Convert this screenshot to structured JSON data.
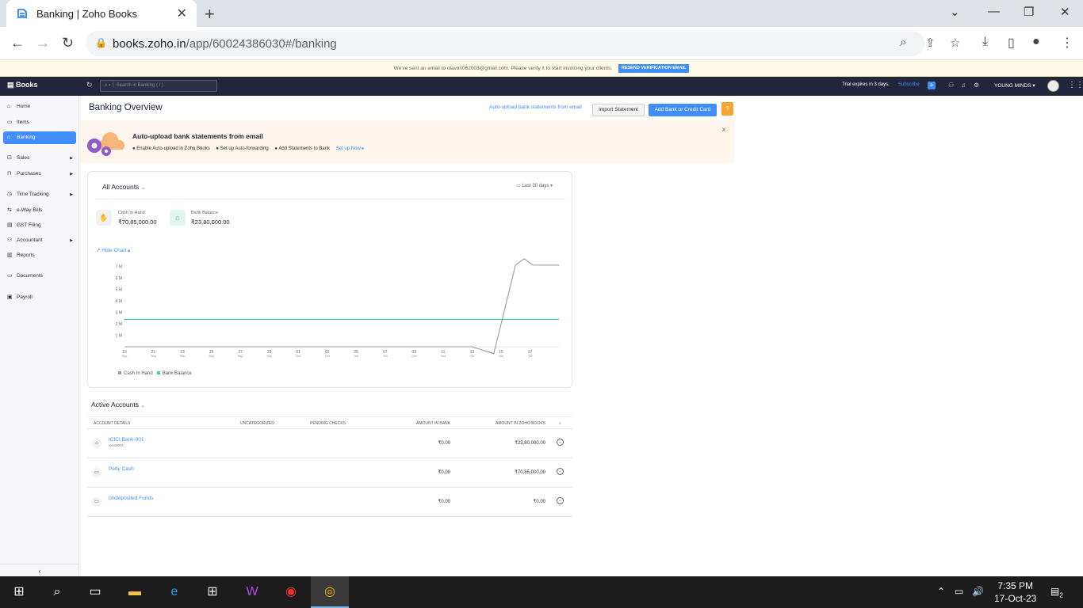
{
  "browser": {
    "tab_title": "Banking | Zoho Books",
    "url_host": "books.zoho.in",
    "url_path": "/app/60024386030#/banking"
  },
  "notice": {
    "text": "We've sent an email to olavori062003@gmail.com. Please verify it to start invoicing your clients.",
    "button": "RESEND VERIFICATION EMAIL"
  },
  "header": {
    "brand": "Books",
    "search_placeholder": "Search in Banking ( / )",
    "trial": "Trial expires in 3 days.",
    "subscribe": "Subscribe",
    "org": "YOUNG MINDS ▾"
  },
  "sidebar": {
    "items": [
      {
        "label": "Home",
        "icon": "home-icon"
      },
      {
        "label": "Items",
        "icon": "items-icon"
      },
      {
        "label": "Banking",
        "icon": "bank-icon",
        "active": true
      },
      {
        "label": "Sales",
        "icon": "cart-icon"
      },
      {
        "label": "Purchases",
        "icon": "bag-icon"
      },
      {
        "label": "Time Tracking",
        "icon": "clock-icon"
      },
      {
        "label": "e-Way Bills",
        "icon": "truck-icon"
      },
      {
        "label": "GST Filing",
        "icon": "file-icon"
      },
      {
        "label": "Accountant",
        "icon": "person-icon"
      },
      {
        "label": "Reports",
        "icon": "reports-icon"
      },
      {
        "label": "Documents",
        "icon": "folder-icon"
      },
      {
        "label": "Payroll",
        "icon": "payroll-icon"
      }
    ]
  },
  "main": {
    "title": "Banking Overview",
    "auto_upload_link": "Auto-upload bank statements from email",
    "import_button": "Import Statement",
    "add_button": "Add Bank or Credit Card",
    "help": "?"
  },
  "banner": {
    "title": "Auto-upload bank statements from email",
    "step1": "● Enable Auto-upload in Zoho Books",
    "step2": "● Set up Auto-forwarding",
    "step3": "● Add Statements to Bank",
    "setup": "Set up Now ▸",
    "close": "x"
  },
  "overview": {
    "account_selector": "All Accounts",
    "period": "Last 30 days",
    "cash_label": "Cash In Hand",
    "cash_value": "₹70,85,000.00",
    "bank_label": "Bank Balance",
    "bank_value": "₹23,80,000.00",
    "hide_chart": "Hide Chart"
  },
  "chart_data": {
    "type": "line",
    "y_ticks": [
      "1 M",
      "2 M",
      "3 M",
      "4 M",
      "5 M",
      "6 M",
      "7 M"
    ],
    "ylim": [
      0,
      7500000
    ],
    "x_ticks": [
      {
        "d": "19",
        "m": "Sep"
      },
      {
        "d": "21",
        "m": "Sep"
      },
      {
        "d": "23",
        "m": "Sep"
      },
      {
        "d": "25",
        "m": "Sep"
      },
      {
        "d": "27",
        "m": "Sep"
      },
      {
        "d": "29",
        "m": "Sep"
      },
      {
        "d": "01",
        "m": "Oct"
      },
      {
        "d": "03",
        "m": "Oct"
      },
      {
        "d": "05",
        "m": "Oct"
      },
      {
        "d": "07",
        "m": "Oct"
      },
      {
        "d": "09",
        "m": "Oct"
      },
      {
        "d": "11",
        "m": "Oct"
      },
      {
        "d": "13",
        "m": "Oct"
      },
      {
        "d": "15",
        "m": "Oct"
      },
      {
        "d": "17",
        "m": "Oct"
      }
    ],
    "x_days": [
      0,
      30
    ],
    "series": [
      {
        "name": "Cash In Hand",
        "color": "#9a9a9a",
        "points": [
          [
            0,
            0
          ],
          [
            24,
            0
          ],
          [
            25.5,
            -600000
          ],
          [
            26.2,
            3000000
          ],
          [
            27,
            7100000
          ],
          [
            27.6,
            7650000
          ],
          [
            28.2,
            7100000
          ],
          [
            30,
            7085000
          ]
        ]
      },
      {
        "name": "Bank Balance",
        "color": "#3ccf9a",
        "points": [
          [
            0,
            2380000
          ],
          [
            30,
            2380000
          ]
        ]
      }
    ]
  },
  "accounts": {
    "heading": "Active Accounts",
    "columns": [
      "ACCOUNT DETAILS",
      "UNCATEGORIZED",
      "PENDING CHECKS",
      "AMOUNT IN BANK",
      "AMOUNT IN ZOHO BOOKS"
    ],
    "rows": [
      {
        "name": "ICICI Bank-001",
        "sub": "xxxx0001",
        "bank": "₹0.00",
        "books": "₹23,80,000.00",
        "icon": "bank-icon"
      },
      {
        "name": "Petty Cash",
        "sub": "",
        "bank": "₹0.00",
        "books": "₹70,85,000.00",
        "icon": "cash-icon"
      },
      {
        "name": "Undeposited Funds",
        "sub": "",
        "bank": "₹0.00",
        "books": "₹0.00",
        "icon": "cash-icon"
      }
    ]
  },
  "taskbar": {
    "time": "7:35 PM",
    "date": "17-Oct-23",
    "notif_count": "2"
  }
}
